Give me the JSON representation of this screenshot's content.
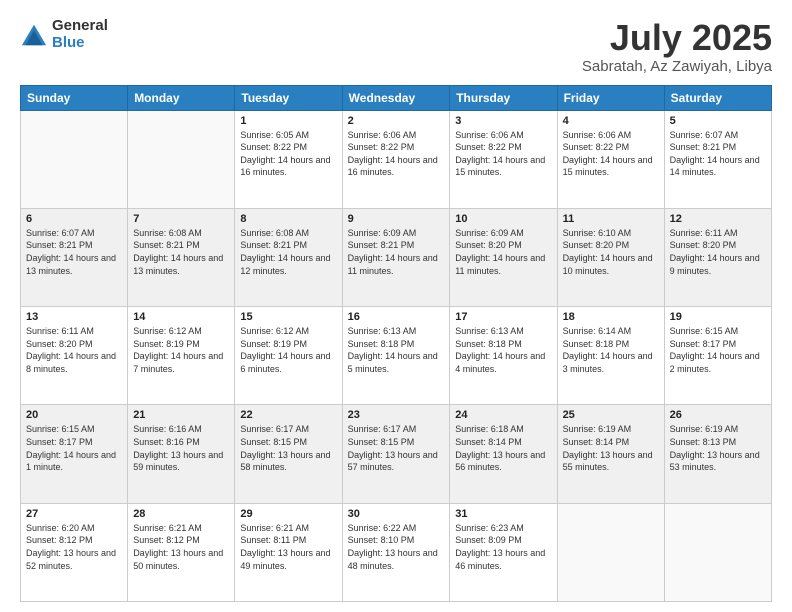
{
  "header": {
    "logo": {
      "general": "General",
      "blue": "Blue"
    },
    "title": "July 2025",
    "subtitle": "Sabratah, Az Zawiyah, Libya"
  },
  "weekdays": [
    "Sunday",
    "Monday",
    "Tuesday",
    "Wednesday",
    "Thursday",
    "Friday",
    "Saturday"
  ],
  "weeks": [
    [
      {
        "day": "",
        "info": ""
      },
      {
        "day": "",
        "info": ""
      },
      {
        "day": "1",
        "info": "Sunrise: 6:05 AM\nSunset: 8:22 PM\nDaylight: 14 hours and 16 minutes."
      },
      {
        "day": "2",
        "info": "Sunrise: 6:06 AM\nSunset: 8:22 PM\nDaylight: 14 hours and 16 minutes."
      },
      {
        "day": "3",
        "info": "Sunrise: 6:06 AM\nSunset: 8:22 PM\nDaylight: 14 hours and 15 minutes."
      },
      {
        "day": "4",
        "info": "Sunrise: 6:06 AM\nSunset: 8:22 PM\nDaylight: 14 hours and 15 minutes."
      },
      {
        "day": "5",
        "info": "Sunrise: 6:07 AM\nSunset: 8:21 PM\nDaylight: 14 hours and 14 minutes."
      }
    ],
    [
      {
        "day": "6",
        "info": "Sunrise: 6:07 AM\nSunset: 8:21 PM\nDaylight: 14 hours and 13 minutes."
      },
      {
        "day": "7",
        "info": "Sunrise: 6:08 AM\nSunset: 8:21 PM\nDaylight: 14 hours and 13 minutes."
      },
      {
        "day": "8",
        "info": "Sunrise: 6:08 AM\nSunset: 8:21 PM\nDaylight: 14 hours and 12 minutes."
      },
      {
        "day": "9",
        "info": "Sunrise: 6:09 AM\nSunset: 8:21 PM\nDaylight: 14 hours and 11 minutes."
      },
      {
        "day": "10",
        "info": "Sunrise: 6:09 AM\nSunset: 8:20 PM\nDaylight: 14 hours and 11 minutes."
      },
      {
        "day": "11",
        "info": "Sunrise: 6:10 AM\nSunset: 8:20 PM\nDaylight: 14 hours and 10 minutes."
      },
      {
        "day": "12",
        "info": "Sunrise: 6:11 AM\nSunset: 8:20 PM\nDaylight: 14 hours and 9 minutes."
      }
    ],
    [
      {
        "day": "13",
        "info": "Sunrise: 6:11 AM\nSunset: 8:20 PM\nDaylight: 14 hours and 8 minutes."
      },
      {
        "day": "14",
        "info": "Sunrise: 6:12 AM\nSunset: 8:19 PM\nDaylight: 14 hours and 7 minutes."
      },
      {
        "day": "15",
        "info": "Sunrise: 6:12 AM\nSunset: 8:19 PM\nDaylight: 14 hours and 6 minutes."
      },
      {
        "day": "16",
        "info": "Sunrise: 6:13 AM\nSunset: 8:18 PM\nDaylight: 14 hours and 5 minutes."
      },
      {
        "day": "17",
        "info": "Sunrise: 6:13 AM\nSunset: 8:18 PM\nDaylight: 14 hours and 4 minutes."
      },
      {
        "day": "18",
        "info": "Sunrise: 6:14 AM\nSunset: 8:18 PM\nDaylight: 14 hours and 3 minutes."
      },
      {
        "day": "19",
        "info": "Sunrise: 6:15 AM\nSunset: 8:17 PM\nDaylight: 14 hours and 2 minutes."
      }
    ],
    [
      {
        "day": "20",
        "info": "Sunrise: 6:15 AM\nSunset: 8:17 PM\nDaylight: 14 hours and 1 minute."
      },
      {
        "day": "21",
        "info": "Sunrise: 6:16 AM\nSunset: 8:16 PM\nDaylight: 13 hours and 59 minutes."
      },
      {
        "day": "22",
        "info": "Sunrise: 6:17 AM\nSunset: 8:15 PM\nDaylight: 13 hours and 58 minutes."
      },
      {
        "day": "23",
        "info": "Sunrise: 6:17 AM\nSunset: 8:15 PM\nDaylight: 13 hours and 57 minutes."
      },
      {
        "day": "24",
        "info": "Sunrise: 6:18 AM\nSunset: 8:14 PM\nDaylight: 13 hours and 56 minutes."
      },
      {
        "day": "25",
        "info": "Sunrise: 6:19 AM\nSunset: 8:14 PM\nDaylight: 13 hours and 55 minutes."
      },
      {
        "day": "26",
        "info": "Sunrise: 6:19 AM\nSunset: 8:13 PM\nDaylight: 13 hours and 53 minutes."
      }
    ],
    [
      {
        "day": "27",
        "info": "Sunrise: 6:20 AM\nSunset: 8:12 PM\nDaylight: 13 hours and 52 minutes."
      },
      {
        "day": "28",
        "info": "Sunrise: 6:21 AM\nSunset: 8:12 PM\nDaylight: 13 hours and 50 minutes."
      },
      {
        "day": "29",
        "info": "Sunrise: 6:21 AM\nSunset: 8:11 PM\nDaylight: 13 hours and 49 minutes."
      },
      {
        "day": "30",
        "info": "Sunrise: 6:22 AM\nSunset: 8:10 PM\nDaylight: 13 hours and 48 minutes."
      },
      {
        "day": "31",
        "info": "Sunrise: 6:23 AM\nSunset: 8:09 PM\nDaylight: 13 hours and 46 minutes."
      },
      {
        "day": "",
        "info": ""
      },
      {
        "day": "",
        "info": ""
      }
    ]
  ]
}
